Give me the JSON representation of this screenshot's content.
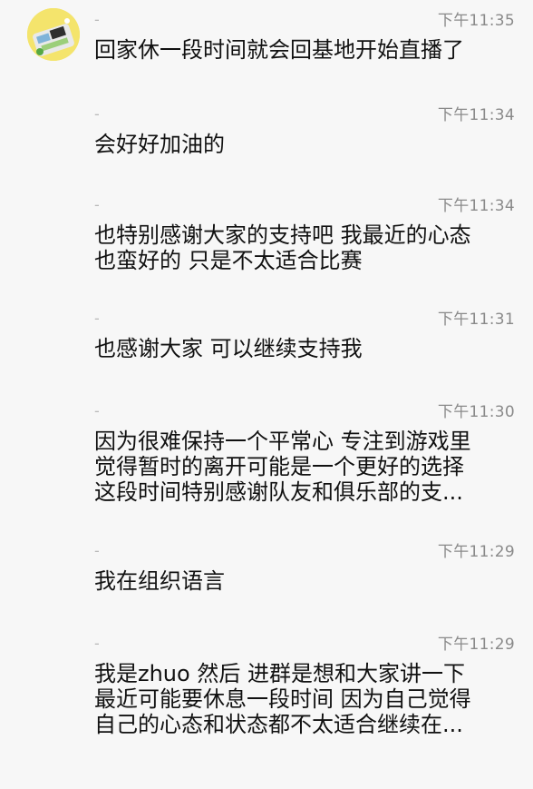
{
  "messages": [
    {
      "sender": "-",
      "time": "下午11:35",
      "lines": [
        "回家休一段时间就会回基地开始直播了"
      ]
    },
    {
      "sender": "-",
      "time": "下午11:34",
      "lines": [
        "会好好加油的"
      ]
    },
    {
      "sender": "-",
      "time": "下午11:34",
      "lines": [
        "也特别感谢大家的支持吧 我最近的心态",
        "也蛮好的 只是不太适合比赛"
      ]
    },
    {
      "sender": "-",
      "time": "下午11:31",
      "lines": [
        "也感谢大家 可以继续支持我"
      ]
    },
    {
      "sender": "-",
      "time": "下午11:30",
      "lines": [
        "因为很难保持一个平常心 专注到游戏里",
        "觉得暂时的离开可能是一个更好的选择",
        "这段时间特别感谢队友和俱乐部的支..."
      ]
    },
    {
      "sender": "-",
      "time": "下午11:29",
      "lines": [
        "我在组织语言"
      ]
    },
    {
      "sender": "-",
      "time": "下午11:29",
      "lines": [
        "我是zhuo 然后 进群是想和大家讲一下",
        "最近可能要休息一段时间 因为自己觉得",
        "自己的心态和状态都不太适合继续在..."
      ]
    }
  ],
  "colors": {
    "background": "#f7f7f7",
    "text": "#111111",
    "time": "#8a8a8a",
    "sender": "#b9b9b9"
  }
}
